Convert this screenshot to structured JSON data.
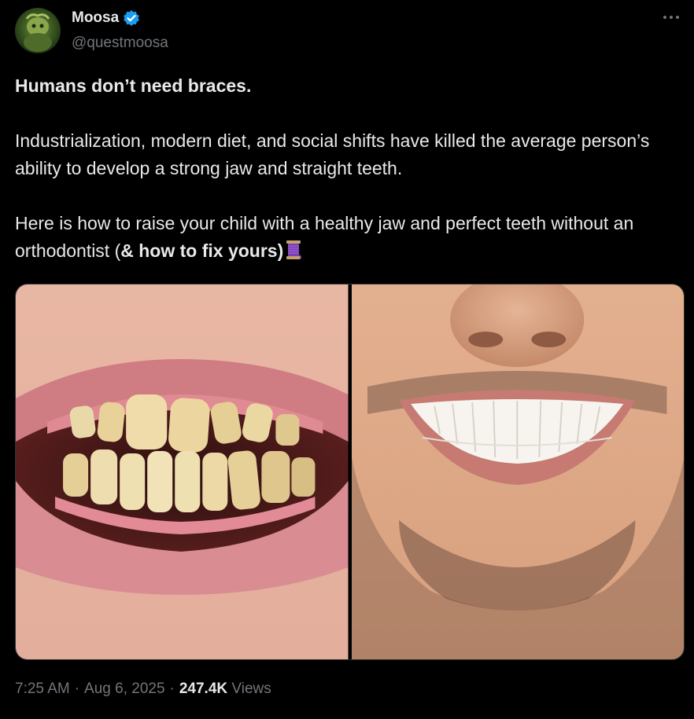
{
  "author": {
    "display_name": "Moosa",
    "handle": "@questmoosa",
    "verified": true,
    "avatar_icon": "green-creature-avatar"
  },
  "tweet": {
    "headline": "Humans don’t need braces.",
    "paragraph_1": "Industrialization, modern diet, and social shifts have killed the average person’s ability to develop a strong jaw and straight teeth.",
    "paragraph_2_plain": "Here is how to raise your child with a healthy jaw and perfect teeth without an orthodontist (",
    "paragraph_2_bold": "& how to fix yours)",
    "emoji": "thread-spool-emoji"
  },
  "media": [
    {
      "icon": "crooked-teeth-photo"
    },
    {
      "icon": "straight-teeth-smile-photo"
    }
  ],
  "meta": {
    "time": "7:25 AM",
    "separator": "·",
    "date": "Aug 6, 2025",
    "views_count": "247.4K",
    "views_label": "Views"
  },
  "colors": {
    "background": "#000000",
    "text": "#e7e9ea",
    "muted": "#71767b",
    "verified_blue": "#1d9bf0"
  }
}
